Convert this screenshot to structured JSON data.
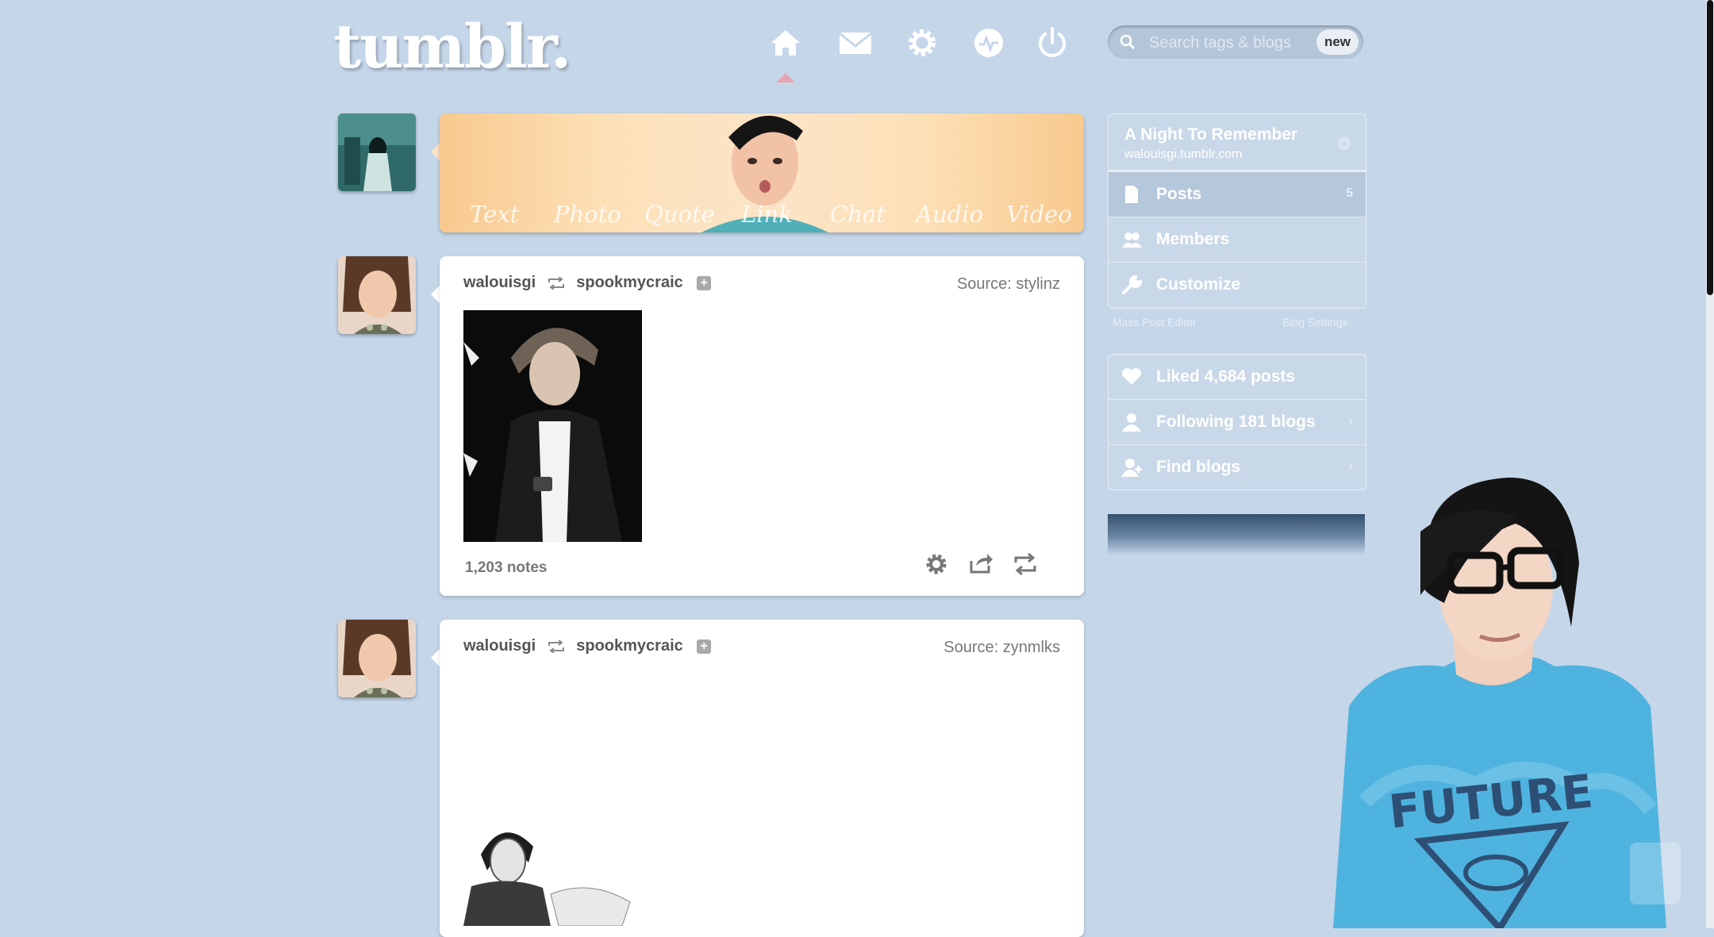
{
  "header": {
    "logo": "tumblr.",
    "nav": [
      "home-icon",
      "mail-icon",
      "gear-icon",
      "activity-icon",
      "power-icon"
    ],
    "search": {
      "placeholder": "Search tags & blogs",
      "badge": "new"
    }
  },
  "post_box": {
    "types": [
      "Text",
      "Photo",
      "Quote",
      "Link",
      "Chat",
      "Audio",
      "Video"
    ]
  },
  "posts": [
    {
      "author": "walouisgi",
      "reblogged_from": "spookmycraic",
      "source": "Source: stylinz",
      "notes": "1,203 notes"
    },
    {
      "author": "walouisgi",
      "reblogged_from": "spookmycraic",
      "source": "Source: zynmlks"
    }
  ],
  "sidebar": {
    "blog_title": "A Night To Remember",
    "blog_url": "walouisgi.tumblr.com",
    "menu": [
      {
        "label": "Posts",
        "count": "5",
        "icon": "posts-icon"
      },
      {
        "label": "Members",
        "icon": "members-icon"
      },
      {
        "label": "Customize",
        "icon": "wrench-icon"
      }
    ],
    "links": [
      "Mass Post Editor",
      "Blog Settings"
    ],
    "activity": [
      {
        "label": "Liked 4,684 posts",
        "icon": "heart-icon"
      },
      {
        "label": "Following 181 blogs",
        "icon": "person-icon"
      },
      {
        "label": "Find blogs",
        "icon": "find-blogs-icon"
      }
    ]
  },
  "colors": {
    "background": "#c5d6e9",
    "post_bg": "#ffffff",
    "sidebar_bg": "#c9d8e8",
    "nav_active_caret": "#e6a5b2"
  }
}
